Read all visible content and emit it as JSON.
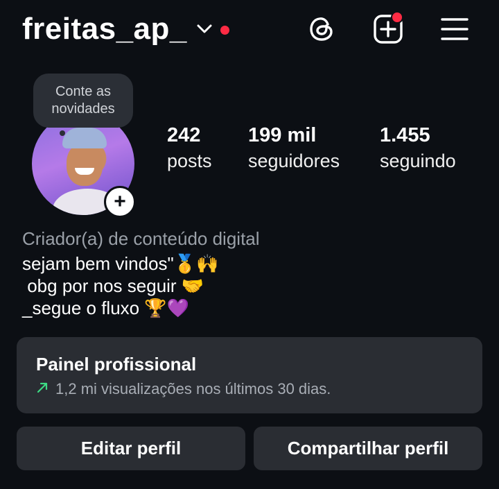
{
  "header": {
    "username": "freitas_ap_",
    "icons": [
      "chevron-down-icon",
      "threads-icon",
      "new-post-icon",
      "menu-icon"
    ],
    "accent_color": "#ff2b44"
  },
  "note_bubble": {
    "text_line1": "Conte as",
    "text_line2": "novidades"
  },
  "stats": {
    "posts": {
      "value": "242",
      "label": "posts"
    },
    "followers": {
      "value": "199 mil",
      "label": "seguidores"
    },
    "following": {
      "value": "1.455",
      "label": "seguindo"
    }
  },
  "profile": {
    "category": "Criador(a) de conteúdo digital",
    "bio_lines": [
      "sejam bem vindos\"🥇🙌",
      " obg por nos seguir 🤝",
      "_segue o fluxo 🏆💜"
    ]
  },
  "professional_panel": {
    "title": "Painel profissional",
    "subtitle": "1,2 mi visualizações nos últimos 30 dias.",
    "trend_color": "#3ddc84"
  },
  "buttons": {
    "edit": "Editar perfil",
    "share": "Compartilhar perfil"
  }
}
